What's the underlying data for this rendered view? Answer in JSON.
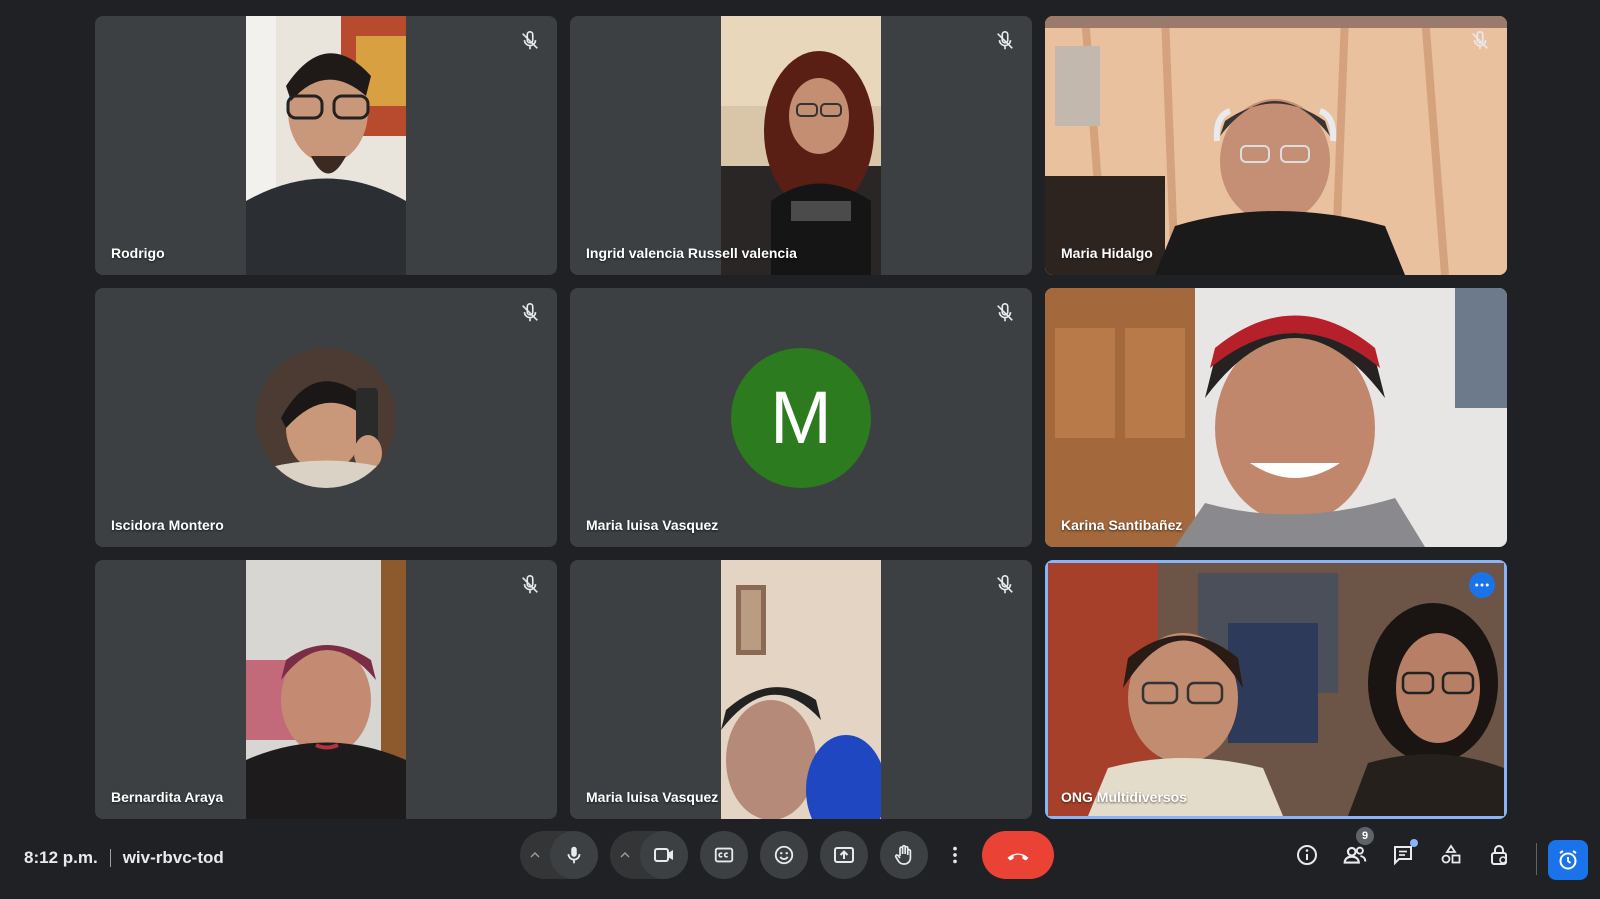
{
  "meeting": {
    "time": "8:12 p.m.",
    "code": "wiv-rbvc-tod"
  },
  "participants": [
    {
      "name": "Rodrigo",
      "muted": true,
      "has_video": true
    },
    {
      "name": "Ingrid valencia Russell valencia",
      "muted": true,
      "has_video": true
    },
    {
      "name": "Maria Hidalgo",
      "muted": true,
      "has_video": true
    },
    {
      "name": "Iscidora Montero",
      "muted": true,
      "has_video": false,
      "avatar": "photo"
    },
    {
      "name": "Maria luisa Vasquez",
      "muted": true,
      "has_video": false,
      "avatar_letter": "M",
      "avatar_color": "#2d7b1f"
    },
    {
      "name": "Karina Santibañez",
      "muted": false,
      "has_video": true
    },
    {
      "name": "Bernardita Araya",
      "muted": true,
      "has_video": true
    },
    {
      "name": "Maria luisa Vasquez",
      "muted": true,
      "has_video": true
    },
    {
      "name": "ONG Multidiversos",
      "muted": false,
      "has_video": true,
      "active_speaker": true
    }
  ],
  "toolbar": {
    "participant_count": "9",
    "icons": {
      "mic": "microphone-icon",
      "camera": "camera-icon",
      "captions": "captions-icon",
      "reactions": "emoji-icon",
      "present": "present-screen-icon",
      "hand": "raise-hand-icon",
      "more": "more-options-icon",
      "end": "end-call-icon",
      "info": "info-icon",
      "people": "people-icon",
      "chat": "chat-icon",
      "activities": "activities-icon",
      "host": "host-controls-icon",
      "timer": "timer-icon"
    }
  },
  "colors": {
    "background": "#202124",
    "tile": "#3c4043",
    "active_border": "#8ab4f8",
    "end_call": "#ea4335",
    "accent": "#1a73e8"
  }
}
